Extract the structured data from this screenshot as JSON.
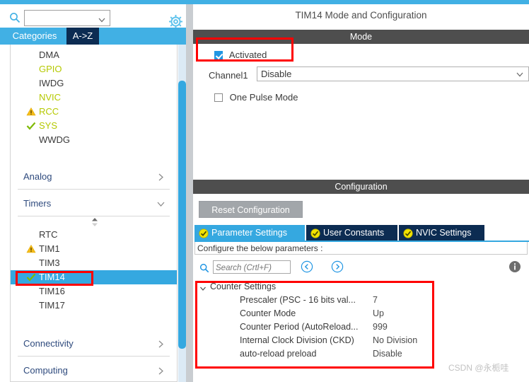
{
  "window": {
    "accent_blue": "#41b0e4",
    "dark_navy": "#0c2c52",
    "annotation_color": "#ff0000"
  },
  "sidebar": {
    "search": {
      "value": "",
      "placeholder": ""
    },
    "gear_title": "Settings",
    "tabs": [
      {
        "label": "Categories",
        "active": true
      },
      {
        "label": "A->Z",
        "active": false
      }
    ],
    "peripherals": [
      {
        "label": "DMA",
        "status": "none",
        "selected": false
      },
      {
        "label": "GPIO",
        "status": "none",
        "selected": false
      },
      {
        "label": "IWDG",
        "status": "none",
        "selected": false
      },
      {
        "label": "NVIC",
        "status": "none",
        "selected": false
      },
      {
        "label": "RCC",
        "status": "warning",
        "selected": false
      },
      {
        "label": "SYS",
        "status": "check",
        "selected": false
      },
      {
        "label": "WWDG",
        "status": "none",
        "selected": false
      }
    ],
    "groups": [
      {
        "label": "Analog",
        "expanded": false
      },
      {
        "label": "Timers",
        "expanded": true
      },
      {
        "label": "Connectivity",
        "expanded": false
      },
      {
        "label": "Computing",
        "expanded": false
      }
    ],
    "timers": [
      {
        "label": "RTC",
        "status": "none",
        "selected": false
      },
      {
        "label": "TIM1",
        "status": "warning",
        "selected": false
      },
      {
        "label": "TIM3",
        "status": "none",
        "selected": false
      },
      {
        "label": "TIM14",
        "status": "check",
        "selected": true
      },
      {
        "label": "TIM16",
        "status": "none",
        "selected": false
      },
      {
        "label": "TIM17",
        "status": "none",
        "selected": false
      }
    ]
  },
  "main": {
    "title": "TIM14 Mode and Configuration",
    "mode": {
      "section_label": "Mode",
      "activated_label": "Activated",
      "activated_checked": true,
      "channel1_label": "Channel1",
      "channel1_value": "Disable",
      "one_pulse_label": "One Pulse Mode",
      "one_pulse_checked": false
    },
    "configuration": {
      "section_label": "Configuration",
      "reset_label": "Reset Configuration",
      "tabs": [
        {
          "label": "Parameter Settings",
          "active": true
        },
        {
          "label": "User Constants",
          "active": false
        },
        {
          "label": "NVIC Settings",
          "active": false
        }
      ],
      "hint": "Configure the below parameters :",
      "search": {
        "value": "",
        "placeholder": "Search (Crtl+F)"
      },
      "tree": {
        "group_label": "Counter Settings",
        "rows": [
          {
            "name": "Prescaler (PSC - 16 bits val...",
            "value": "7"
          },
          {
            "name": "Counter Mode",
            "value": "Up"
          },
          {
            "name": "Counter Period (AutoReload...",
            "value": "999"
          },
          {
            "name": "Internal Clock Division (CKD)",
            "value": "No Division"
          },
          {
            "name": "auto-reload preload",
            "value": "Disable"
          }
        ]
      }
    }
  },
  "watermark": {
    "text": "CSDN @永栀哇"
  }
}
